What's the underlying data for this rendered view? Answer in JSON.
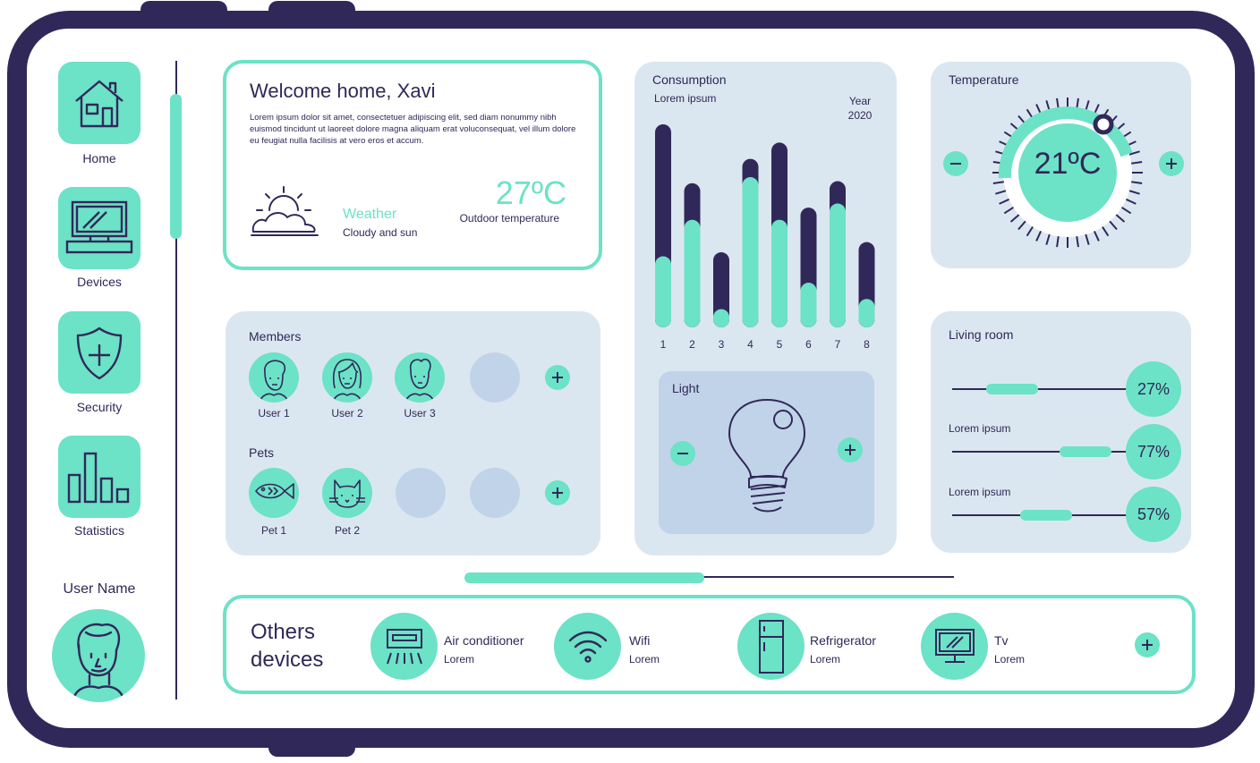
{
  "sidebar": {
    "items": [
      {
        "label": "Home",
        "icon": "house-icon"
      },
      {
        "label": "Devices",
        "icon": "computer-icon"
      },
      {
        "label": "Security",
        "icon": "shield-plus-icon"
      },
      {
        "label": "Statistics",
        "icon": "bar-chart-icon"
      }
    ],
    "user_name": "User Name"
  },
  "welcome": {
    "title": "Welcome home, Xavi",
    "body": "Lorem ipsum dolor sit amet, consectetuer adipiscing elit, sed diam nonummy nibh euismod tincidunt ut laoreet dolore magna aliquam erat voluconsequat, vel illum dolore eu feugiat nulla facilisis at vero eros et accum.",
    "weather_label": "Weather",
    "weather_desc": "Cloudy and sun",
    "outdoor_temp": "27ºC",
    "outdoor_label": "Outdoor temperature"
  },
  "members": {
    "title": "Members",
    "users": [
      "User 1",
      "User 2",
      "User 3"
    ],
    "pets_title": "Pets",
    "pets": [
      "Pet 1",
      "Pet 2"
    ]
  },
  "consumption": {
    "title": "Consumption",
    "subtitle": "Lorem ipsum",
    "year_label": "Year",
    "year": "2020"
  },
  "chart_data": {
    "type": "bar",
    "categories": [
      "1",
      "2",
      "3",
      "4",
      "5",
      "6",
      "7",
      "8"
    ],
    "series": [
      {
        "values": [
          10,
          7.1,
          3.7,
          8.3,
          9.1,
          5.9,
          7.2,
          4.2
        ]
      },
      {
        "values": [
          3.5,
          5.3,
          0.9,
          7.4,
          5.3,
          2.2,
          6.1,
          1.4
        ]
      }
    ],
    "ylim": [
      0,
      10
    ],
    "colors": [
      "#31285a",
      "#6ce2c6"
    ]
  },
  "light": {
    "title": "Light"
  },
  "temperature": {
    "title": "Temperature",
    "value": "21ºC",
    "minus": "−",
    "plus": "+"
  },
  "living_room": {
    "title": "Living room",
    "sliders": [
      {
        "label": "",
        "value": "27%",
        "level": 0.27
      },
      {
        "label": "Lorem ipsum",
        "value": "77%",
        "level": 0.77
      },
      {
        "label": "Lorem ipsum",
        "value": "57%",
        "level": 0.57
      }
    ]
  },
  "others": {
    "title_line1": "Others",
    "title_line2": "devices",
    "devices": [
      {
        "name": "Air conditioner",
        "sub": "Lorem",
        "icon": "air-conditioner-icon"
      },
      {
        "name": "Wifi",
        "sub": "Lorem",
        "icon": "wifi-icon"
      },
      {
        "name": "Refrigerator",
        "sub": "Lorem",
        "icon": "refrigerator-icon"
      },
      {
        "name": "Tv",
        "sub": "Lorem",
        "icon": "tv-icon"
      }
    ]
  },
  "colors": {
    "navy": "#31285a",
    "mint": "#6ce2c6",
    "panel": "#dbe7f0",
    "panel_dark": "#c1d3e8"
  }
}
